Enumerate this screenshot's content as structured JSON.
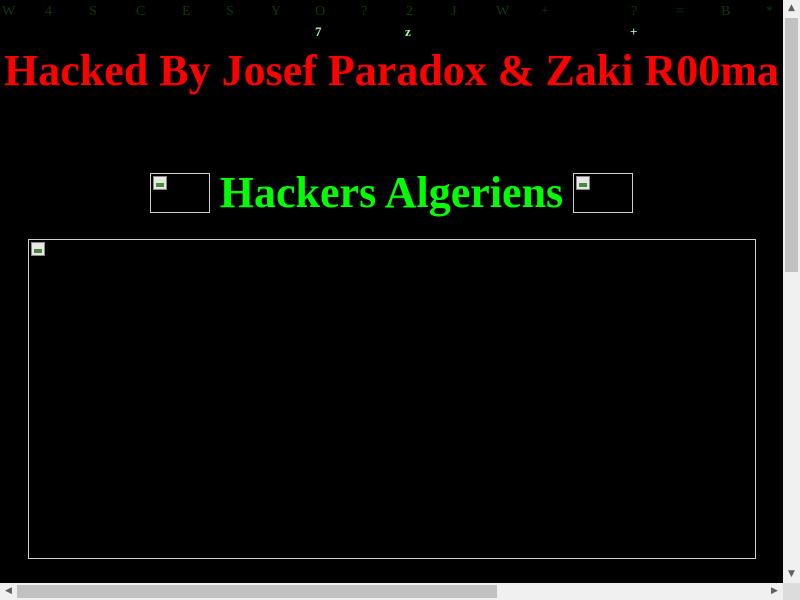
{
  "matrix_top": [
    "W",
    "4",
    "S",
    "C",
    "E",
    "S",
    "Y",
    "O",
    "?",
    "2",
    "J",
    "W",
    "+",
    "",
    "?",
    "=",
    "B",
    "*"
  ],
  "matrix_second": [
    "7",
    "z",
    "+"
  ],
  "title": "Hacked By Josef Paradox & Zaki R00ma",
  "subtitle": "Hackers Algeriens",
  "icons": {
    "scroll_up": "scroll-up-arrow",
    "scroll_down": "scroll-down-arrow",
    "scroll_left": "scroll-left-arrow",
    "scroll_right": "scroll-right-arrow",
    "broken_image": "broken-image-icon"
  },
  "colors": {
    "background": "#000000",
    "title": "#ff0000",
    "subtitle": "#00ff00",
    "matrix_dim": "#0a3a0a",
    "matrix_bright": "#9dff9d"
  }
}
